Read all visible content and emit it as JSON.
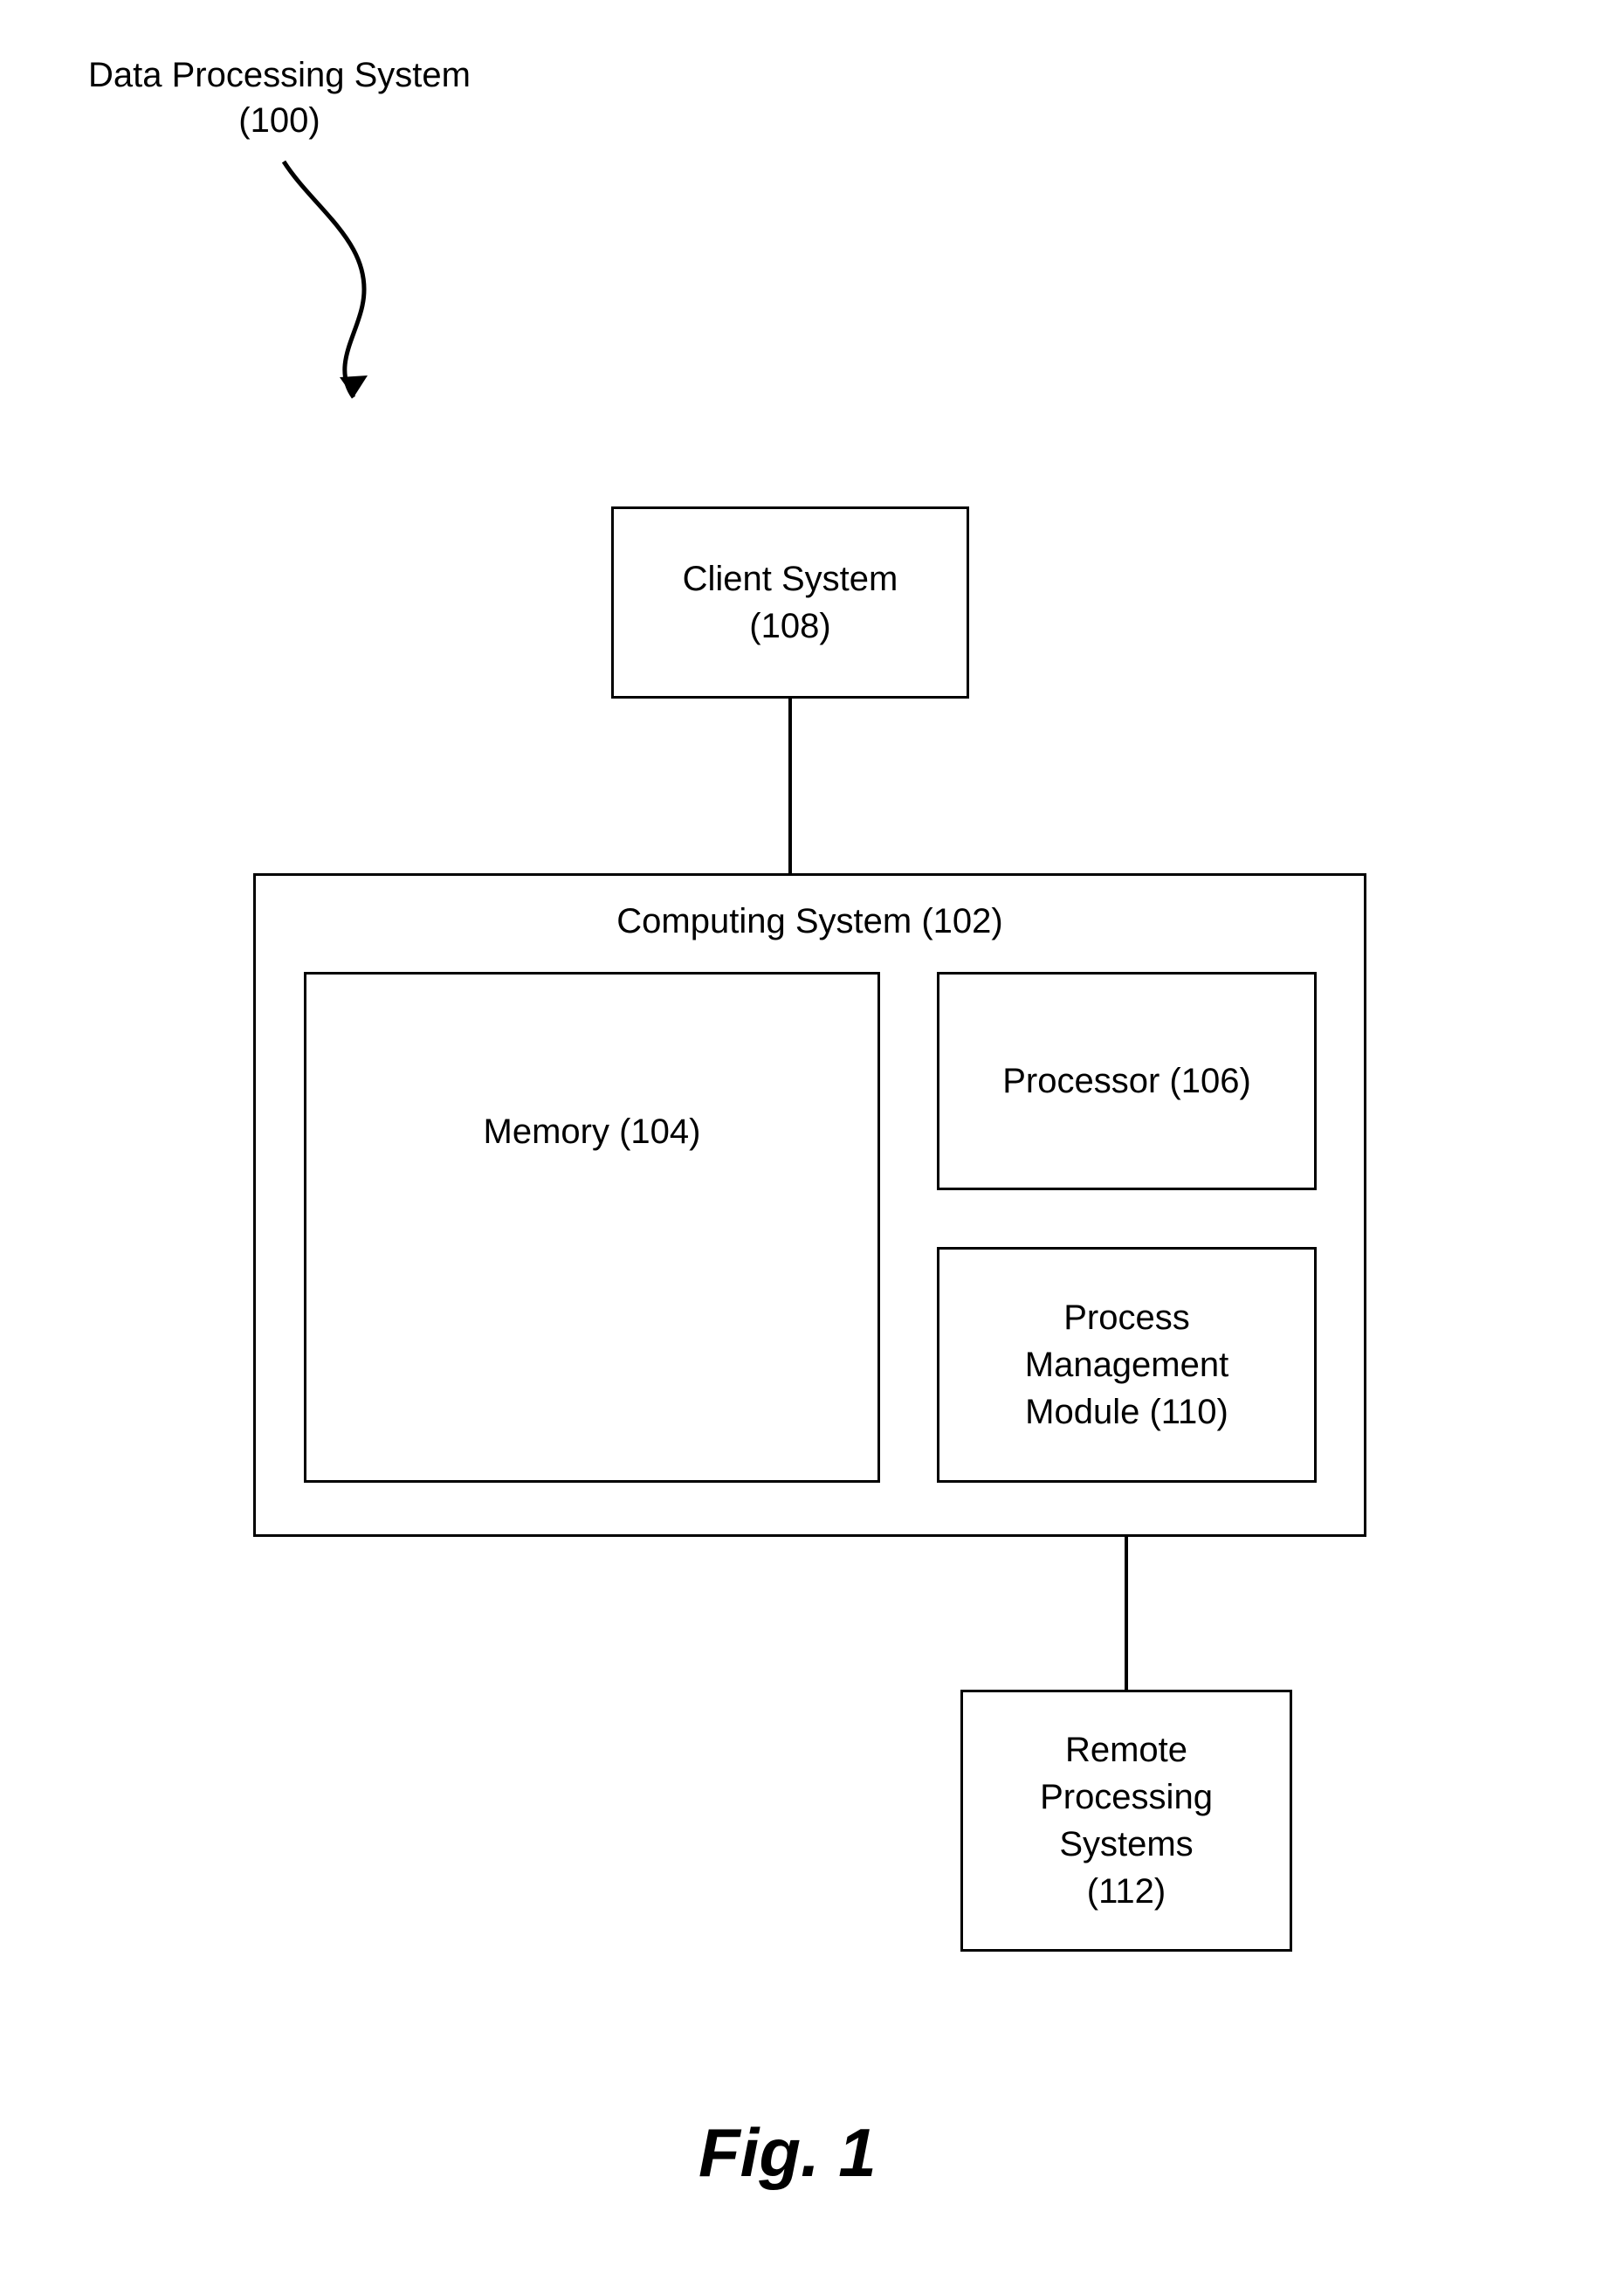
{
  "title": {
    "line1": "Data Processing System",
    "line2": "(100)"
  },
  "clientSystem": {
    "line1": "Client System",
    "line2": "(108)"
  },
  "computingSystem": {
    "title": "Computing System (102)"
  },
  "memory": {
    "label": "Memory (104)"
  },
  "processor": {
    "label": "Processor (106)"
  },
  "processManagement": {
    "line1": "Process",
    "line2": "Management",
    "line3": "Module (110)"
  },
  "remoteProcessing": {
    "line1": "Remote",
    "line2": "Processing",
    "line3": "Systems",
    "line4": "(112)"
  },
  "figure": {
    "caption": "Fig. 1"
  }
}
